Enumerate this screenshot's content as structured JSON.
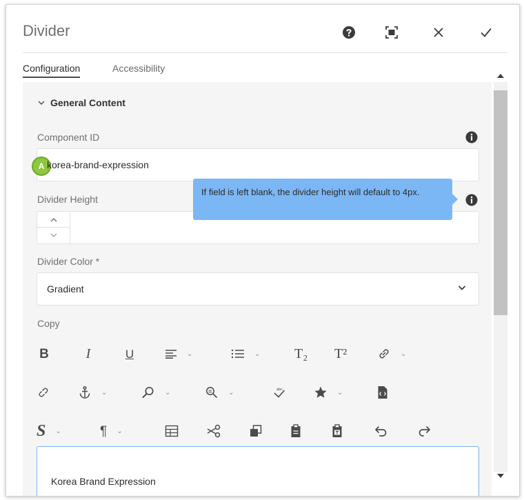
{
  "dialog": {
    "title": "Divider",
    "actions": [
      "help-icon",
      "fullscreen-icon",
      "close-icon",
      "check-icon"
    ]
  },
  "tabs": [
    {
      "label": "Configuration",
      "active": true
    },
    {
      "label": "Accessibility",
      "active": false
    }
  ],
  "section": {
    "label": "General Content",
    "icon": "chevron-down-icon"
  },
  "component_id": {
    "label": "Component ID",
    "value": "korea-brand-expression",
    "badge": "A"
  },
  "divider_height": {
    "label": "Divider Height",
    "value": "",
    "tooltip": "If field is left blank, the divider height will default to 4px."
  },
  "divider_color": {
    "label": "Divider Color *",
    "value": "Gradient"
  },
  "copy": {
    "label": "Copy",
    "editor_text": "Korea Brand Expression",
    "toolbar": {
      "bold": "B",
      "italic": "I",
      "underline": "U",
      "subscript": "T₂",
      "superscript": "T²",
      "style": "S",
      "paragraph": "¶",
      "caret": "⌄"
    }
  },
  "colors": {
    "accent": "#7cb7f5",
    "badge": "#8dc63f",
    "panel": "#f5f5f5"
  }
}
